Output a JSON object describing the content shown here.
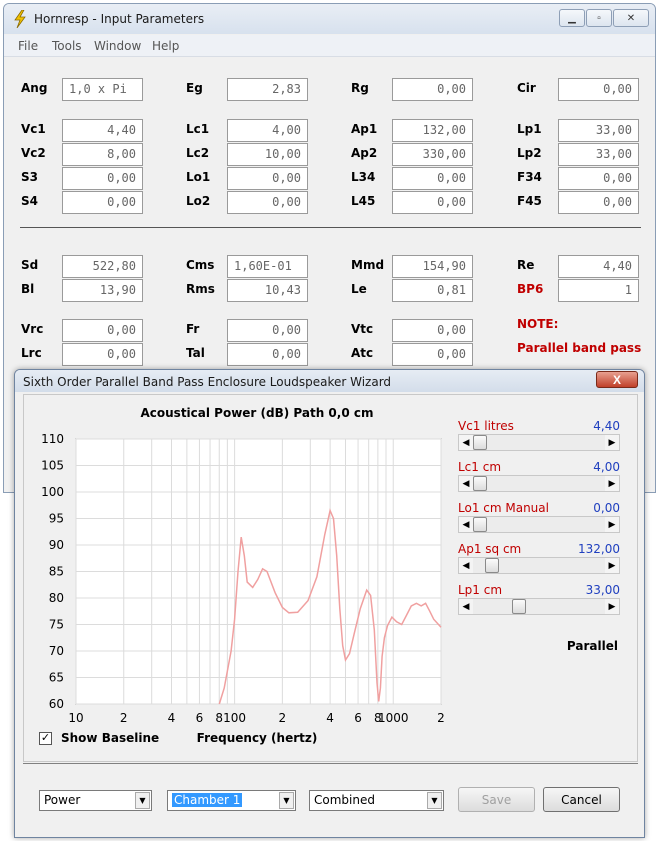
{
  "main_window": {
    "title": "Hornresp - Input Parameters",
    "menu": [
      "File",
      "Tools",
      "Window",
      "Help"
    ],
    "rows": [
      [
        [
          "Ang",
          "1,0 x Pi"
        ],
        [
          "Eg",
          "2,83"
        ],
        [
          "Rg",
          "0,00"
        ],
        [
          "Cir",
          "0,00"
        ]
      ],
      [
        [
          "Vc1",
          "4,40"
        ],
        [
          "Lc1",
          "4,00"
        ],
        [
          "Ap1",
          "132,00"
        ],
        [
          "Lp1",
          "33,00"
        ]
      ],
      [
        [
          "Vc2",
          "8,00"
        ],
        [
          "Lc2",
          "10,00"
        ],
        [
          "Ap2",
          "330,00"
        ],
        [
          "Lp2",
          "33,00"
        ]
      ],
      [
        [
          "S3",
          "0,00"
        ],
        [
          "Lo1",
          "0,00"
        ],
        [
          "L34",
          "0,00"
        ],
        [
          "F34",
          "0,00"
        ]
      ],
      [
        [
          "S4",
          "0,00"
        ],
        [
          "Lo2",
          "0,00"
        ],
        [
          "L45",
          "0,00"
        ],
        [
          "F45",
          "0,00"
        ]
      ],
      [
        [
          "Sd",
          "522,80"
        ],
        [
          "Cms",
          "1,60E-01"
        ],
        [
          "Mmd",
          "154,90"
        ],
        [
          "Re",
          "4,40"
        ]
      ],
      [
        [
          "Bl",
          "13,90"
        ],
        [
          "Rms",
          "10,43"
        ],
        [
          "Le",
          "0,81"
        ],
        [
          "BP6",
          "1"
        ]
      ],
      [
        [
          "Vrc",
          "0,00"
        ],
        [
          "Fr",
          "0,00"
        ],
        [
          "Vtc",
          "0,00"
        ]
      ],
      [
        [
          "Lrc",
          "0,00"
        ],
        [
          "Tal",
          "0,00"
        ],
        [
          "Atc",
          "0,00"
        ]
      ]
    ],
    "note_label": "NOTE:",
    "note_text": "Parallel band pass"
  },
  "wizard": {
    "title": "Sixth Order Parallel Band Pass Enclosure Loudspeaker Wizard",
    "close_glyph": "X",
    "sliders": [
      {
        "label": "Vc1  litres",
        "value": "4,40",
        "red": true,
        "position": 0.0
      },
      {
        "label": "Lc1  cm",
        "value": "4,00",
        "red": true,
        "position": 0.0
      },
      {
        "label": "Lo1  cm  Manual",
        "value": "0,00",
        "red": true,
        "position": 0.0
      },
      {
        "label": "Ap1  sq cm",
        "value": "132,00",
        "red": true,
        "position": 0.1
      },
      {
        "label": "Lp1  cm",
        "value": "33,00",
        "red": true,
        "position": 0.33
      }
    ],
    "mode_text": "Parallel",
    "show_baseline_label": "Show Baseline",
    "show_baseline_checked": "✓",
    "combo_power": "Power",
    "combo_chamber": "Chamber 1",
    "combo_combined": "Combined",
    "save_label": "Save",
    "cancel_label": "Cancel"
  },
  "chart_data": {
    "type": "line",
    "title": "Acoustical Power (dB)   Path 0,0 cm",
    "xlabel": "Frequency (hertz)",
    "ylabel": "",
    "x_scale": "log",
    "xlim": [
      10,
      2000
    ],
    "ylim": [
      60,
      110
    ],
    "yticks": [
      "60",
      "65",
      "70",
      "75",
      "80",
      "85",
      "90",
      "95",
      "100",
      "105",
      "110"
    ],
    "xtick_labels": [
      {
        "x": 10,
        "label": "10"
      },
      {
        "x": 20,
        "label": "2"
      },
      {
        "x": 40,
        "label": "4"
      },
      {
        "x": 60,
        "label": "6"
      },
      {
        "x": 80,
        "label": "8"
      },
      {
        "x": 100,
        "label": "100"
      },
      {
        "x": 200,
        "label": "2"
      },
      {
        "x": 400,
        "label": "4"
      },
      {
        "x": 600,
        "label": "6"
      },
      {
        "x": 800,
        "label": "8"
      },
      {
        "x": 1000,
        "label": "1000"
      },
      {
        "x": 2000,
        "label": "2"
      }
    ],
    "grid": true,
    "line_color": "#f0a0a0",
    "series": [
      {
        "x": [
          80,
          86,
          95,
          100,
          105,
          110,
          115,
          120,
          130,
          140,
          150,
          160,
          180,
          200,
          220,
          250,
          290,
          330,
          370,
          400,
          420,
          440,
          460,
          480,
          500,
          530,
          570,
          620,
          680,
          720,
          760,
          790,
          810,
          830,
          850,
          880,
          920,
          980,
          1050,
          1130,
          1200,
          1300,
          1400,
          1500,
          1600,
          1700,
          1800,
          2000
        ],
        "y": [
          60,
          63,
          70,
          76,
          85,
          91.5,
          88,
          83,
          82,
          83.5,
          85.5,
          85,
          81,
          78.2,
          77.2,
          77.3,
          79.5,
          84,
          92,
          96.5,
          95,
          88,
          78,
          71,
          68.3,
          69.5,
          73.5,
          78,
          81.5,
          80.5,
          74,
          64,
          60.5,
          63,
          69,
          72.5,
          74.8,
          76.4,
          75.5,
          75,
          76.5,
          78.5,
          79,
          78.5,
          79,
          77.5,
          76,
          74.5
        ]
      }
    ]
  }
}
